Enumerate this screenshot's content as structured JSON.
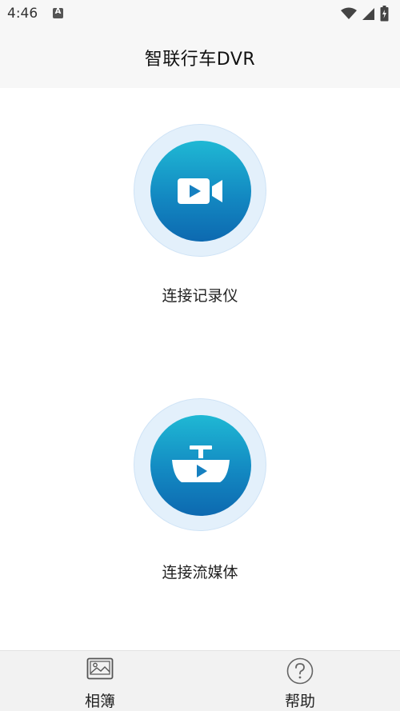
{
  "status_bar": {
    "time": "4:46"
  },
  "header": {
    "title": "智联行车DVR"
  },
  "options": [
    {
      "label": "连接记录仪",
      "icon": "video-camera-icon"
    },
    {
      "label": "连接流媒体",
      "icon": "rearview-mirror-play-icon"
    }
  ],
  "bottom_nav": [
    {
      "label": "相簿",
      "icon": "photo-album-icon"
    },
    {
      "label": "帮助",
      "icon": "help-icon"
    }
  ],
  "colors": {
    "accent_top": "#1fb8d4",
    "accent_bottom": "#0d69b0",
    "ring": "#e3f0fb"
  }
}
